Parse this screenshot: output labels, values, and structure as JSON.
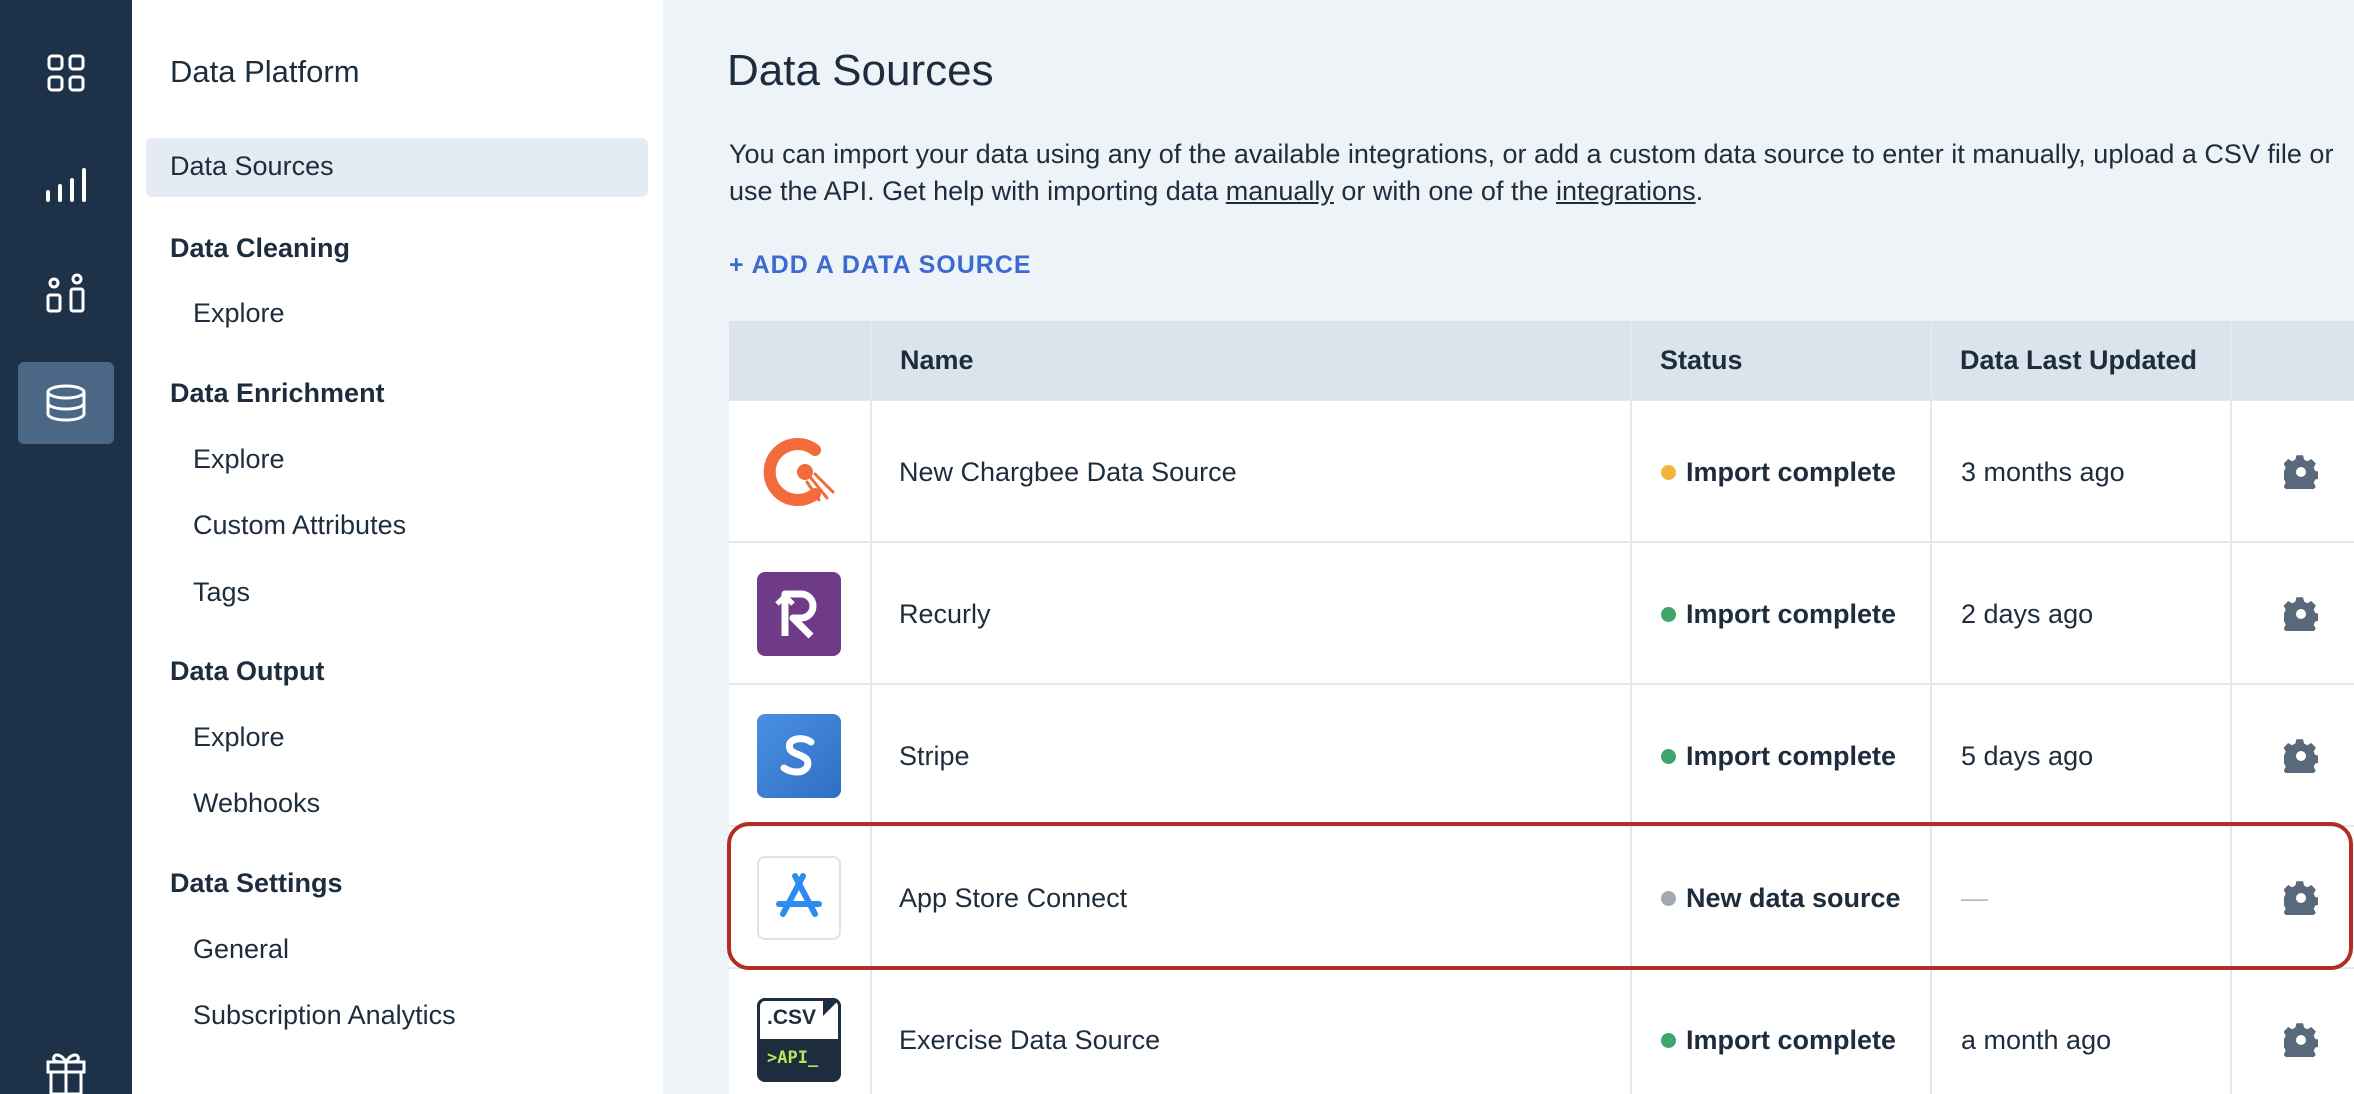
{
  "rail": {
    "items": [
      {
        "icon": "grid-icon"
      },
      {
        "icon": "bar-chart-icon"
      },
      {
        "icon": "people-icon"
      },
      {
        "icon": "database-icon",
        "active": true
      },
      {
        "icon": "gift-icon"
      }
    ]
  },
  "sidebar": {
    "title": "Data Platform",
    "active_item": "Data Sources",
    "sections": [
      {
        "title": "Data Cleaning",
        "items": [
          "Explore"
        ]
      },
      {
        "title": "Data Enrichment",
        "items": [
          "Explore",
          "Custom Attributes",
          "Tags"
        ]
      },
      {
        "title": "Data Output",
        "items": [
          "Explore",
          "Webhooks"
        ]
      },
      {
        "title": "Data Settings",
        "items": [
          "General",
          "Subscription Analytics"
        ]
      }
    ]
  },
  "main": {
    "title": "Data Sources",
    "description_part1": "You can import your data using any of the available integrations, or add a custom data source to enter it manually, upload a CSV file or use the API. Get help with importing data ",
    "link_manually": "manually",
    "description_part2": " or with one of the ",
    "link_integrations": "integrations",
    "description_part3": ".",
    "add_button": "+  ADD A DATA SOURCE",
    "table": {
      "headers": {
        "name": "Name",
        "status": "Status",
        "updated": "Data Last Updated"
      },
      "rows": [
        {
          "logo": "chargebee-logo",
          "name": "New Chargbee Data Source",
          "status": "Import complete",
          "status_color": "#f2b53c",
          "updated": "3 months ago"
        },
        {
          "logo": "recurly-logo",
          "name": "Recurly",
          "status": "Import complete",
          "status_color": "#3fa56b",
          "updated": "2 days ago"
        },
        {
          "logo": "stripe-logo",
          "name": "Stripe",
          "status": "Import complete",
          "status_color": "#3fa56b",
          "updated": "5 days ago"
        },
        {
          "logo": "app-store-logo",
          "name": "App Store Connect",
          "status": "New data source",
          "status_color": "#a3a9b1",
          "updated": "—"
        },
        {
          "logo": "csv-api-logo",
          "name": "Exercise Data Source",
          "status": "Import complete",
          "status_color": "#3fa56b",
          "updated": "a month ago"
        }
      ]
    }
  },
  "csv_logo": {
    "top": ".CSV",
    "bottom": ">API_"
  },
  "colors": {
    "rail": "#1d3148",
    "accent": "#3b6ad1",
    "highlight": "#b22e24"
  }
}
